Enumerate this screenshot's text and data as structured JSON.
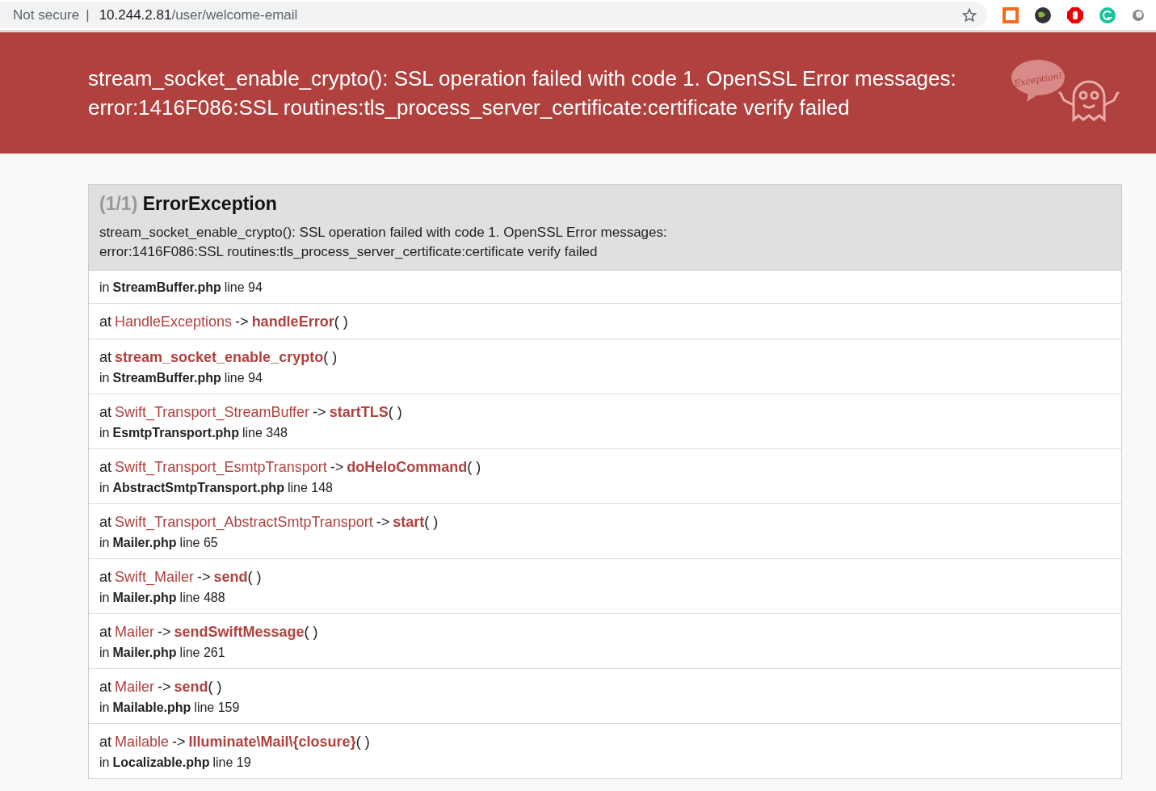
{
  "browser": {
    "security": "Not secure",
    "separator": "|",
    "url_host": "10.244.2.81",
    "url_path": "/user/welcome-email"
  },
  "header": {
    "title_lines": [
      "stream_socket_enable_crypto(): SSL operation failed with code 1. OpenSSL Error messages:",
      "error:1416F086:SSL routines:tls_process_server_certificate:certificate verify failed"
    ],
    "logo_text": "Exception!"
  },
  "exception": {
    "count": "(1/1)",
    "name": "ErrorException",
    "message_lines": [
      "stream_socket_enable_crypto(): SSL operation failed with code 1. OpenSSL Error messages:",
      "error:1416F086:SSL routines:tls_process_server_certificate:certificate verify failed"
    ]
  },
  "frames": [
    {
      "in": "in",
      "file": "StreamBuffer.php",
      "line": "line 94"
    },
    {
      "at": "at",
      "class": "HandleExceptions",
      "arrow": "->",
      "method": "handleError",
      "parens": "( )"
    },
    {
      "at": "at",
      "method": "stream_socket_enable_crypto",
      "parens": "( )",
      "in": "in",
      "file": "StreamBuffer.php",
      "line": "line 94"
    },
    {
      "at": "at",
      "class": "Swift_Transport_StreamBuffer",
      "arrow": "->",
      "method": "startTLS",
      "parens": "( )",
      "in": "in",
      "file": "EsmtpTransport.php",
      "line": "line 348"
    },
    {
      "at": "at",
      "class": "Swift_Transport_EsmtpTransport",
      "arrow": "->",
      "method": "doHeloCommand",
      "parens": "( )",
      "in": "in",
      "file": "AbstractSmtpTransport.php",
      "line": "line 148"
    },
    {
      "at": "at",
      "class": "Swift_Transport_AbstractSmtpTransport",
      "arrow": "->",
      "method": "start",
      "parens": "( )",
      "in": "in",
      "file": "Mailer.php",
      "line": "line 65"
    },
    {
      "at": "at",
      "class": "Swift_Mailer",
      "arrow": "->",
      "method": "send",
      "parens": "( )",
      "in": "in",
      "file": "Mailer.php",
      "line": "line 488"
    },
    {
      "at": "at",
      "class": "Mailer",
      "arrow": "->",
      "method": "sendSwiftMessage",
      "parens": "( )",
      "in": "in",
      "file": "Mailer.php",
      "line": "line 261"
    },
    {
      "at": "at",
      "class": "Mailer",
      "arrow": "->",
      "method": "send",
      "parens": "( )",
      "in": "in",
      "file": "Mailable.php",
      "line": "line 159"
    },
    {
      "at": "at",
      "class": "Mailable",
      "arrow": "->",
      "method": "Illuminate\\Mail\\{closure}",
      "parens": "( )",
      "in": "in",
      "file": "Localizable.php",
      "line": "line 19"
    }
  ]
}
